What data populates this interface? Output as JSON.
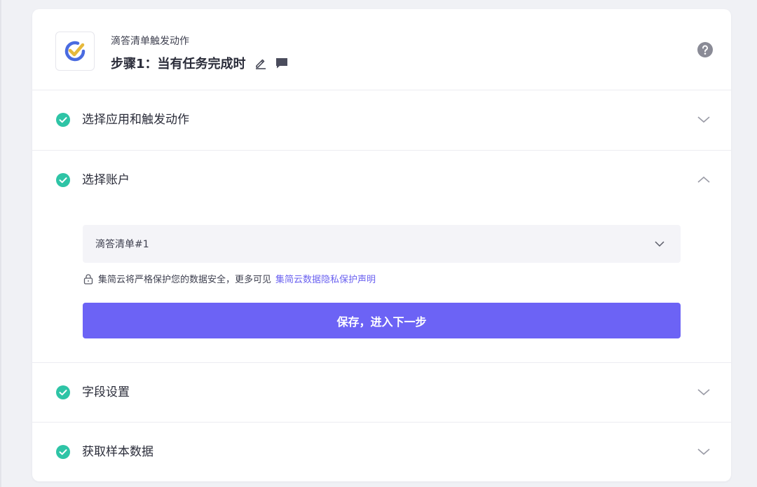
{
  "header": {
    "app_name": "滴答清单触发动作",
    "step_title": "步骤1：当有任务完成时",
    "logo_icon": "ticktick-logo-icon",
    "help_icon": "help-circle-icon"
  },
  "sections": [
    {
      "label": "选择应用和触发动作",
      "state": "collapsed",
      "status": "complete"
    },
    {
      "label": "选择账户",
      "state": "expanded",
      "status": "complete"
    },
    {
      "label": "字段设置",
      "state": "collapsed",
      "status": "complete"
    },
    {
      "label": "获取样本数据",
      "state": "collapsed",
      "status": "complete"
    }
  ],
  "account": {
    "selected": "滴答清单#1",
    "privacy_text": "集简云将严格保护您的数据安全，更多可见",
    "privacy_link": "集简云数据隐私保护声明",
    "save_label": "保存，进入下一步"
  },
  "colors": {
    "accent": "#6c63f5",
    "success": "#2ec4a6",
    "link": "#6b62f0"
  }
}
